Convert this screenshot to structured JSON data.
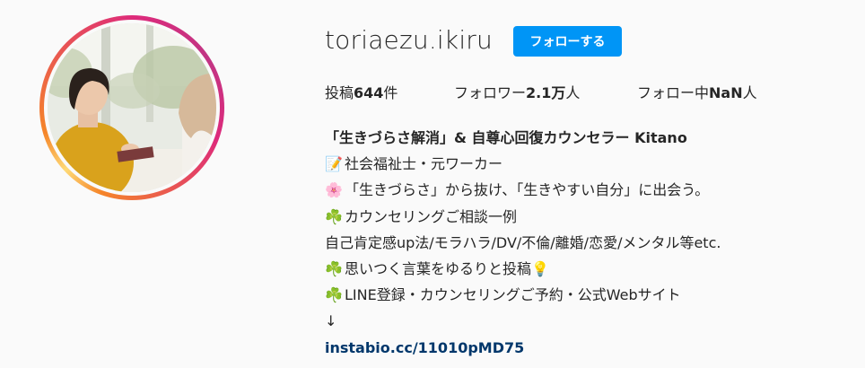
{
  "profile": {
    "username": "toriaezu.ikiru",
    "follow_label": "フォローする"
  },
  "stats": {
    "posts_label": "投稿",
    "posts_count": "644",
    "posts_unit": "件",
    "followers_label": "フォロワー",
    "followers_count": "2.1万",
    "followers_unit": "人",
    "following_label": "フォロー中",
    "following_count": "NaN",
    "following_unit": "人"
  },
  "bio": {
    "name": "「生きづらさ解消」& 自尊心回復カウンセラー Kitano",
    "line1_emoji": "📝",
    "line1": "社会福祉士・元ワーカー",
    "line2_emoji": "🌸",
    "line2": "「生きづらさ」から抜け、「生きやすい自分」に出会う。",
    "line3_emoji": "☘️",
    "line3": "カウンセリングご相談一例",
    "line4": "自己肯定感up法/モラハラ/DV/不倫/離婚/恋愛/メンタル等etc.",
    "line5_emoji": "☘️",
    "line5": "思いつく言葉をゆるりと投稿",
    "line5_trailing_emoji": "💡",
    "line6_emoji": "☘️",
    "line6": "LINE登録・カウンセリングご予約・公式Webサイト",
    "arrow": "↓",
    "link": "instabio.cc/11010pMD75"
  },
  "colors": {
    "follow_button": "#0095f6",
    "link": "#00376b",
    "text": "#262626",
    "background": "#fafafa"
  }
}
